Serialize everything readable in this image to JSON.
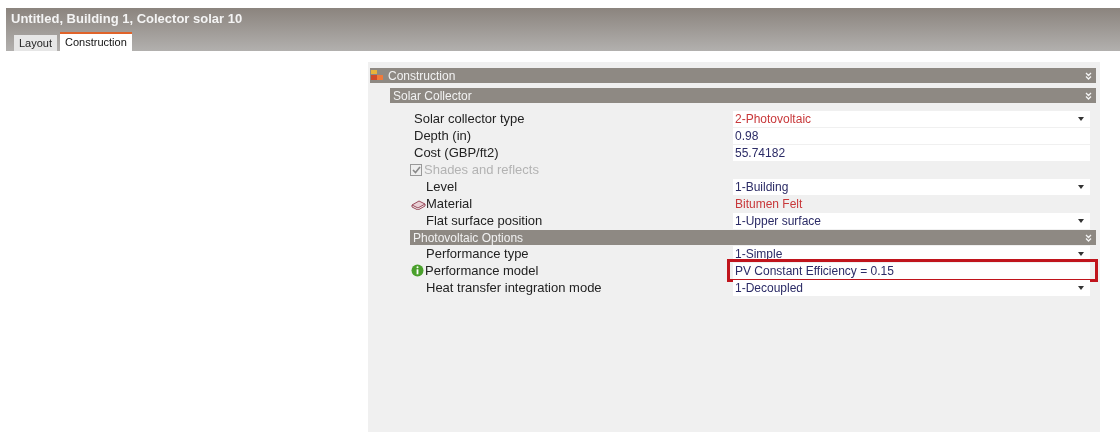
{
  "window": {
    "title": "Untitled, Building 1, Colector solar 10"
  },
  "tabs": [
    {
      "label": "Layout",
      "selected": false
    },
    {
      "label": "Construction",
      "selected": true
    }
  ],
  "panel": {
    "title": "Construction",
    "section": {
      "title": "Solar Collector",
      "rows": [
        {
          "kind": "dropdown",
          "label": "Solar collector type",
          "value": "2-Photovoltaic",
          "color": "#c8383a"
        },
        {
          "kind": "field",
          "label": "Depth (in)",
          "value": "0.98",
          "color": "#2b2b66"
        },
        {
          "kind": "field",
          "label": "Cost (GBP/ft2)",
          "value": "55.74182",
          "color": "#2b2b66"
        },
        {
          "kind": "checkbox",
          "label": "Shades and reflects",
          "checked": true,
          "disabled": true,
          "children": [
            {
              "kind": "dropdown",
              "label": "Level",
              "value": "1-Building",
              "color": "#2b2b66"
            },
            {
              "kind": "link",
              "label": "Material",
              "value": "Bitumen Felt",
              "color": "#c8383a"
            },
            {
              "kind": "dropdown",
              "label": "Flat surface position",
              "value": "1-Upper surface",
              "color": "#2b2b66"
            },
            {
              "kind": "section",
              "label": "Photovoltaic Options",
              "children": [
                {
                  "kind": "dropdown",
                  "label": "Performance type",
                  "value": "1-Simple",
                  "color": "#2b2b66"
                },
                {
                  "kind": "info",
                  "label": "Performance model",
                  "value": "PV Constant Efficiency = 0.15",
                  "color": "#2b2b66",
                  "highlighted": true
                },
                {
                  "kind": "dropdown",
                  "label": "Heat transfer integration mode",
                  "value": "1-Decoupled",
                  "color": "#2b2b66"
                }
              ]
            }
          ]
        }
      ]
    }
  }
}
